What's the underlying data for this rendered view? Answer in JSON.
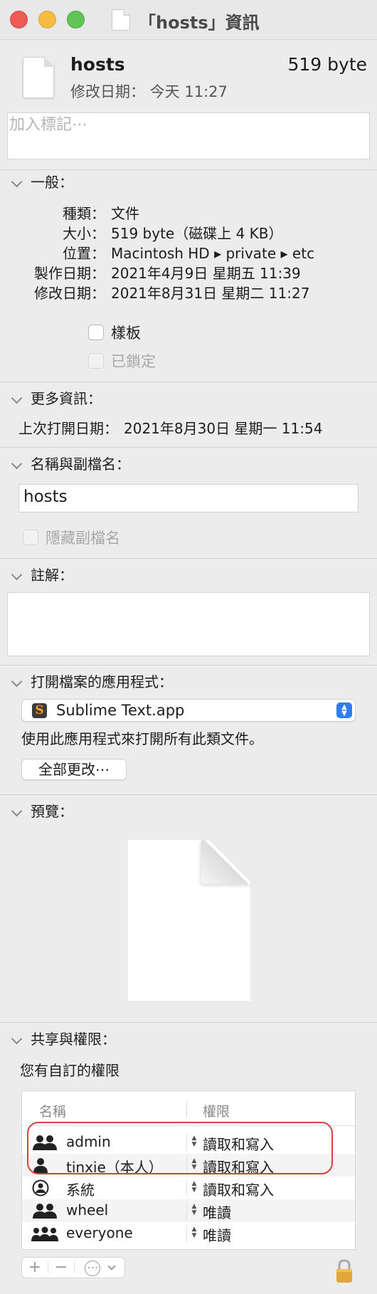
{
  "window": {
    "title": "「hosts」資訊"
  },
  "file": {
    "name": "hosts",
    "size": "519 byte",
    "modified_label": "修改日期：",
    "modified_value": "今天 11:27"
  },
  "tags": {
    "placeholder": "加入標記⋯"
  },
  "general": {
    "header": "一般：",
    "rows": [
      {
        "label": "種類：",
        "value": "文件"
      },
      {
        "label": "大小：",
        "value": "519 byte（磁碟上 4 KB）"
      },
      {
        "label": "位置：",
        "value": "Macintosh HD ▸ private ▸ etc"
      },
      {
        "label": "製作日期：",
        "value": "2021年4月9日 星期五 11:39"
      },
      {
        "label": "修改日期：",
        "value": "2021年8月31日 星期二 11:27"
      }
    ],
    "stationery_label": "樣板",
    "locked_label": "已鎖定"
  },
  "more_info": {
    "header": "更多資訊：",
    "last_opened_label": "上次打開日期：",
    "last_opened_value": "2021年8月30日 星期一 11:54"
  },
  "name_ext": {
    "header": "名稱與副檔名：",
    "value": "hosts",
    "hide_ext_label": "隱藏副檔名"
  },
  "comments": {
    "header": "註解："
  },
  "open_with": {
    "header": "打開檔案的應用程式：",
    "app_name": "Sublime Text.app",
    "app_icon": "sublime-text-icon",
    "use_for_all_text": "使用此應用程式來打開所有此類文件。",
    "change_all_label": "全部更改⋯"
  },
  "preview": {
    "header": "預覽："
  },
  "sharing": {
    "header": "共享與權限：",
    "custom_text": "您有自訂的權限",
    "col_name": "名稱",
    "col_privilege": "權限",
    "rows": [
      {
        "name": "admin",
        "privilege": "讀取和寫入",
        "icon": "group-icon"
      },
      {
        "name": "tinxie（本人）",
        "privilege": "讀取和寫入",
        "icon": "user-icon"
      },
      {
        "name": "系統",
        "privilege": "讀取和寫入",
        "icon": "system-user-icon"
      },
      {
        "name": "wheel",
        "privilege": "唯讀",
        "icon": "group-icon"
      },
      {
        "name": "everyone",
        "privilege": "唯讀",
        "icon": "everyone-icon"
      }
    ],
    "add_label": "+",
    "remove_label": "−",
    "action_label": "⋯"
  },
  "colors": {
    "accent": "#2f7cf6",
    "highlight": "#d3423c",
    "close": "#ee5b54",
    "minimize": "#f4bd3f",
    "zoom": "#5fc454"
  }
}
